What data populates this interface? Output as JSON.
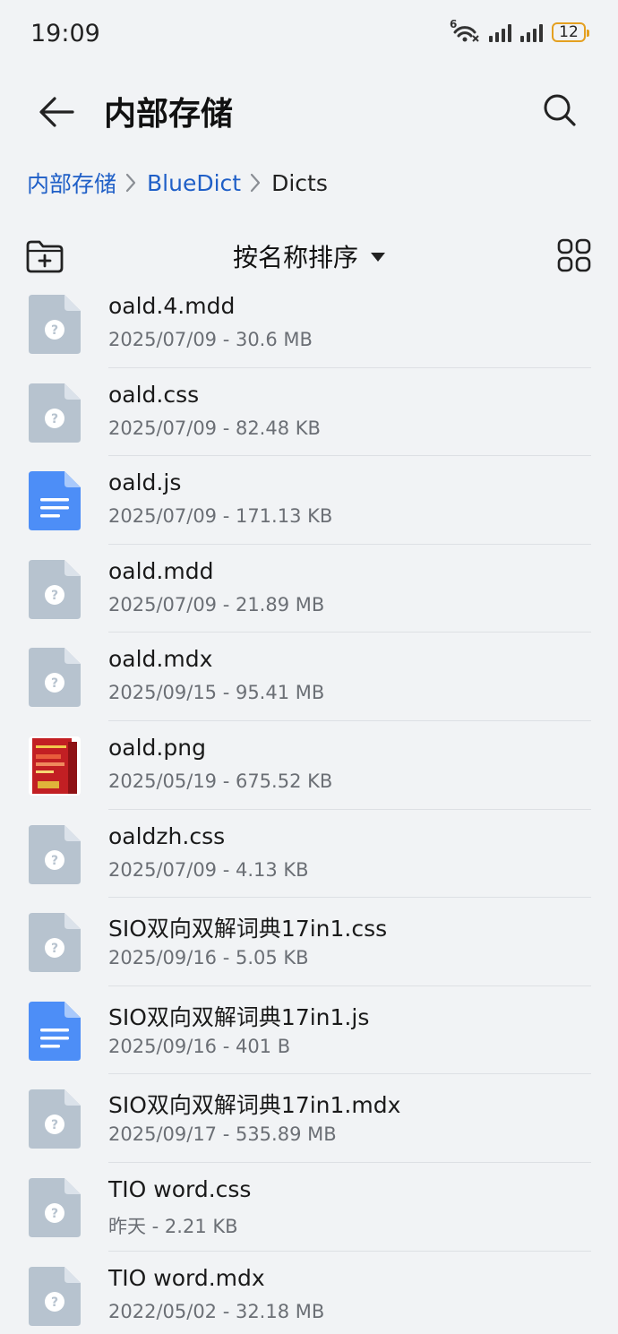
{
  "status": {
    "time": "19:09",
    "wifi_label": "6",
    "battery": "12"
  },
  "header": {
    "title": "内部存储"
  },
  "breadcrumb": {
    "items": [
      "内部存储",
      "BlueDict"
    ],
    "current": "Dicts"
  },
  "toolbar": {
    "sort_label": "按名称排序"
  },
  "colors": {
    "link": "#1f5fc7",
    "unknown_file": "#b7c3cf",
    "doc_file": "#4d8ef7",
    "battery": "#e4a020"
  },
  "files": [
    {
      "name": "oald.4.mdd",
      "meta": "2025/07/09 - 30.6 MB",
      "icon": "unknown-file-icon"
    },
    {
      "name": "oald.css",
      "meta": "2025/07/09 - 82.48 KB",
      "icon": "unknown-file-icon"
    },
    {
      "name": "oald.js",
      "meta": "2025/07/09 - 171.13 KB",
      "icon": "document-file-icon"
    },
    {
      "name": "oald.mdd",
      "meta": "2025/07/09 - 21.89 MB",
      "icon": "unknown-file-icon"
    },
    {
      "name": "oald.mdx",
      "meta": "2025/09/15 - 95.41 MB",
      "icon": "unknown-file-icon"
    },
    {
      "name": "oald.png",
      "meta": "2025/05/19 - 675.52 KB",
      "icon": "image-thumbnail"
    },
    {
      "name": "oaldzh.css",
      "meta": "2025/07/09 - 4.13 KB",
      "icon": "unknown-file-icon"
    },
    {
      "name": "SIO双向双解词典17in1.css",
      "meta": "2025/09/16 - 5.05 KB",
      "icon": "unknown-file-icon"
    },
    {
      "name": "SIO双向双解词典17in1.js",
      "meta": "2025/09/16 - 401 B",
      "icon": "document-file-icon"
    },
    {
      "name": "SIO双向双解词典17in1.mdx",
      "meta": "2025/09/17 - 535.89 MB",
      "icon": "unknown-file-icon"
    },
    {
      "name": "TIO word.css",
      "meta": "昨天 - 2.21 KB",
      "icon": "unknown-file-icon"
    },
    {
      "name": "TIO word.mdx",
      "meta": "2022/05/02 - 32.18 MB",
      "icon": "unknown-file-icon"
    }
  ]
}
